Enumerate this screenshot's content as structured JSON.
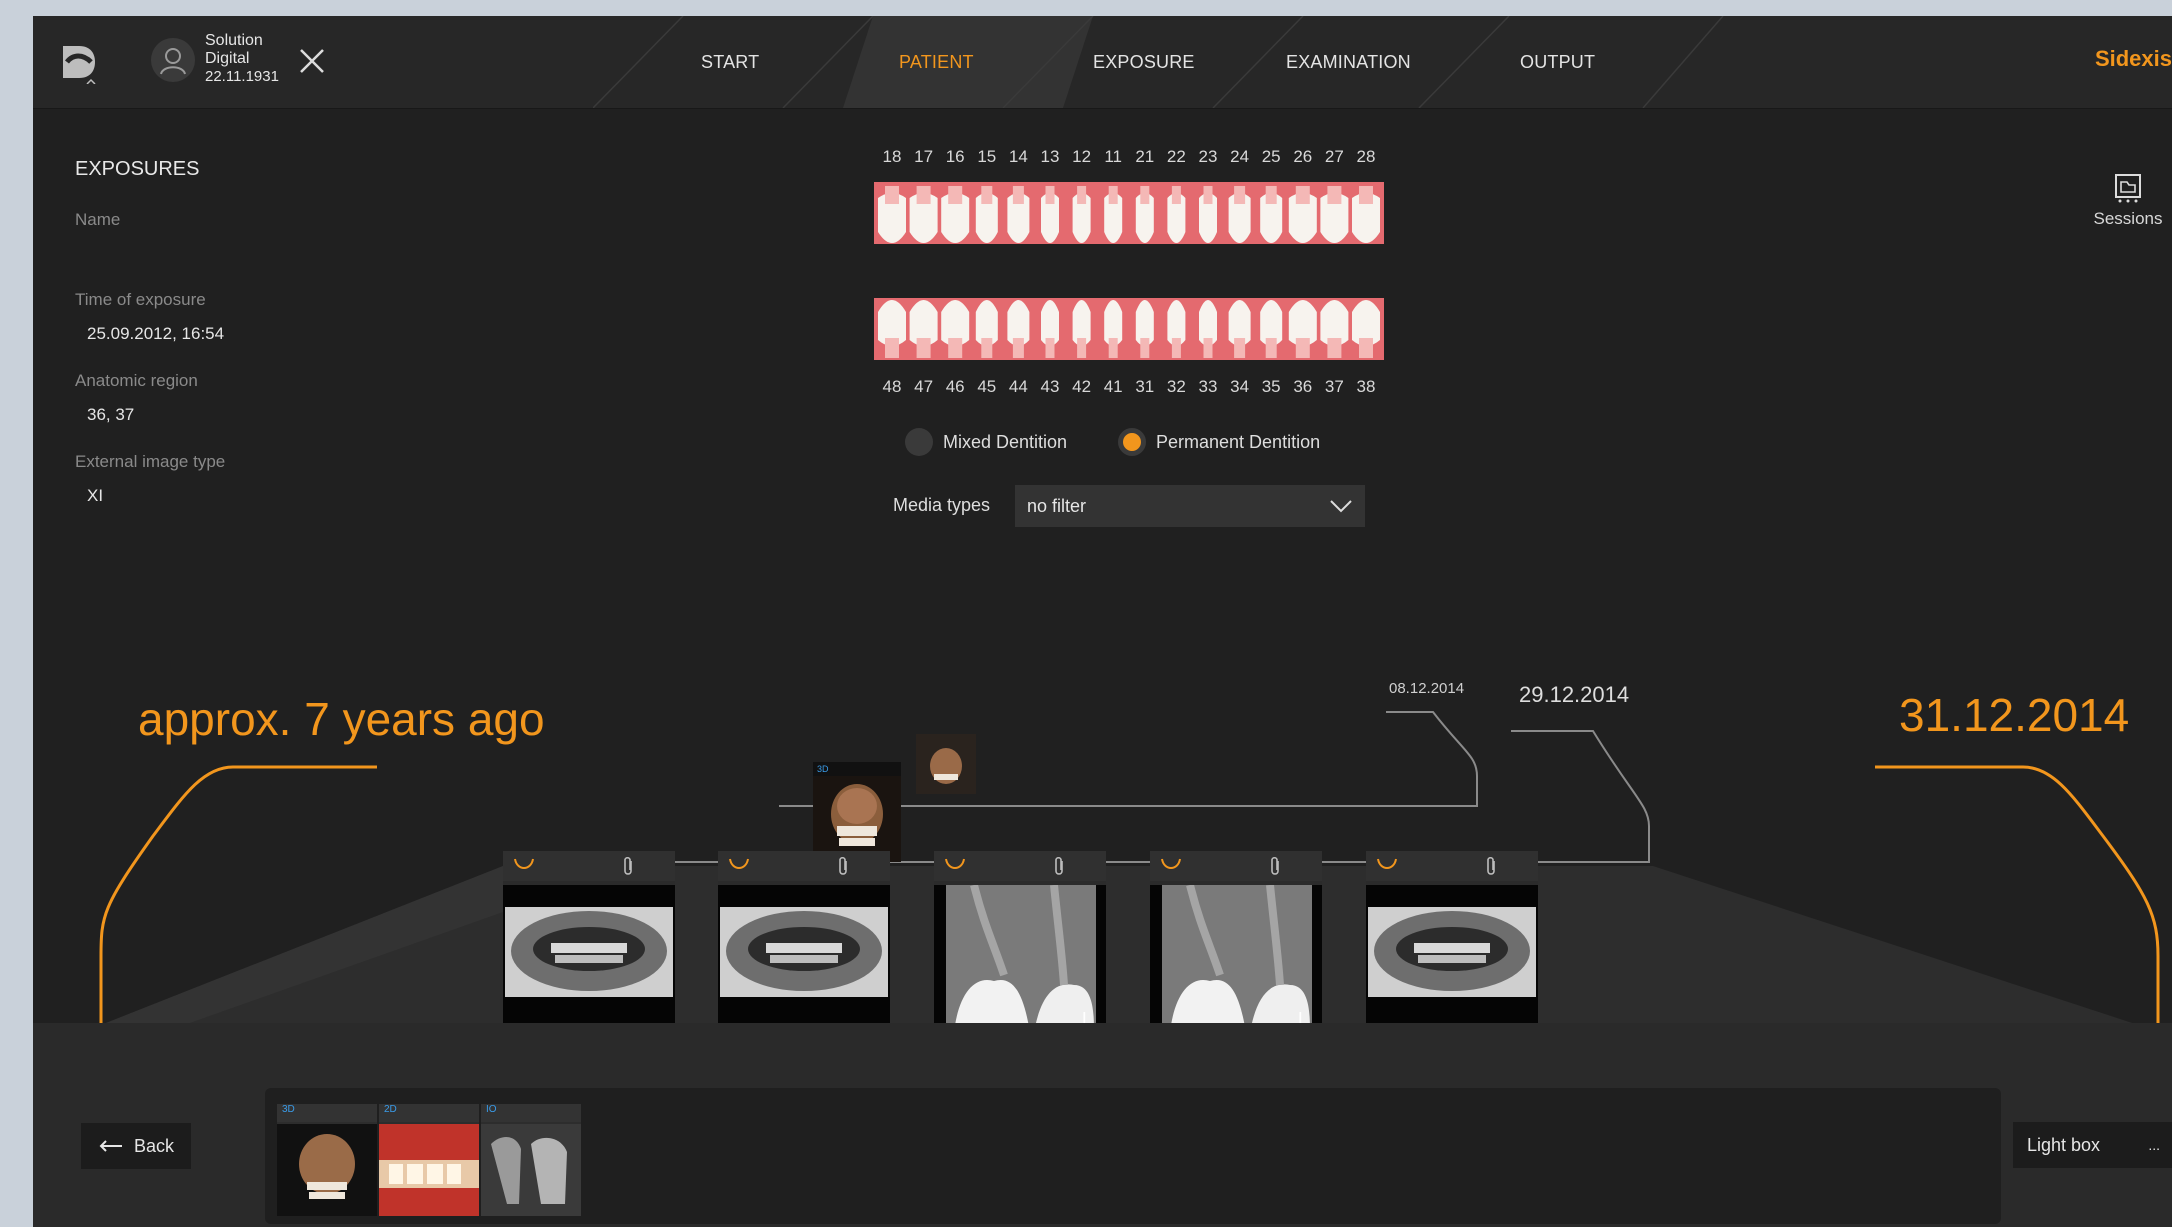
{
  "topbar": {
    "patient": {
      "line1": "Solution",
      "line2": "Digital",
      "dob": "22.11.1931"
    },
    "tabs": [
      {
        "label": "START",
        "active": false
      },
      {
        "label": "PATIENT",
        "active": true
      },
      {
        "label": "EXPOSURE",
        "active": false
      },
      {
        "label": "EXAMINATION",
        "active": false
      },
      {
        "label": "OUTPUT",
        "active": false
      }
    ],
    "brand": "Sidexis",
    "accent_color": "#f2961d"
  },
  "exposures": {
    "title": "EXPOSURES",
    "name_label": "Name",
    "time_label": "Time of exposure",
    "time_value": "25.09.2012, 16:54",
    "region_label": "Anatomic region",
    "region_value": "36, 37",
    "type_label": "External image type",
    "type_value": "XI"
  },
  "teeth": {
    "upper": [
      "18",
      "17",
      "16",
      "15",
      "14",
      "13",
      "12",
      "11",
      "21",
      "22",
      "23",
      "24",
      "25",
      "26",
      "27",
      "28"
    ],
    "lower": [
      "48",
      "47",
      "46",
      "45",
      "44",
      "43",
      "42",
      "41",
      "31",
      "32",
      "33",
      "34",
      "35",
      "36",
      "37",
      "38"
    ]
  },
  "dentition": {
    "mixed_label": "Mixed Dentition",
    "permanent_label": "Permanent Dentition",
    "selected": "permanent"
  },
  "media_types": {
    "label": "Media types",
    "value": "no filter"
  },
  "sessions_label": "Sessions",
  "timeline": {
    "start_label": "approx. 7 years ago",
    "end_label": "31.12.2014",
    "date_small": "08.12.2014",
    "date_mid": "29.12.2014",
    "cards": [
      {
        "kind": "pano",
        "marker": ""
      },
      {
        "kind": "pano",
        "marker": ""
      },
      {
        "kind": "intraoral",
        "marker": "L"
      },
      {
        "kind": "intraoral",
        "marker": "L"
      },
      {
        "kind": "pano",
        "marker": ""
      }
    ],
    "mini_3d_badge": "3D"
  },
  "bottom": {
    "back_label": "Back",
    "lightbox_label": "Light box",
    "lightbox_more": "...",
    "thumbs": [
      {
        "badge": "3D"
      },
      {
        "badge": "2D"
      },
      {
        "badge": "IO"
      }
    ]
  }
}
